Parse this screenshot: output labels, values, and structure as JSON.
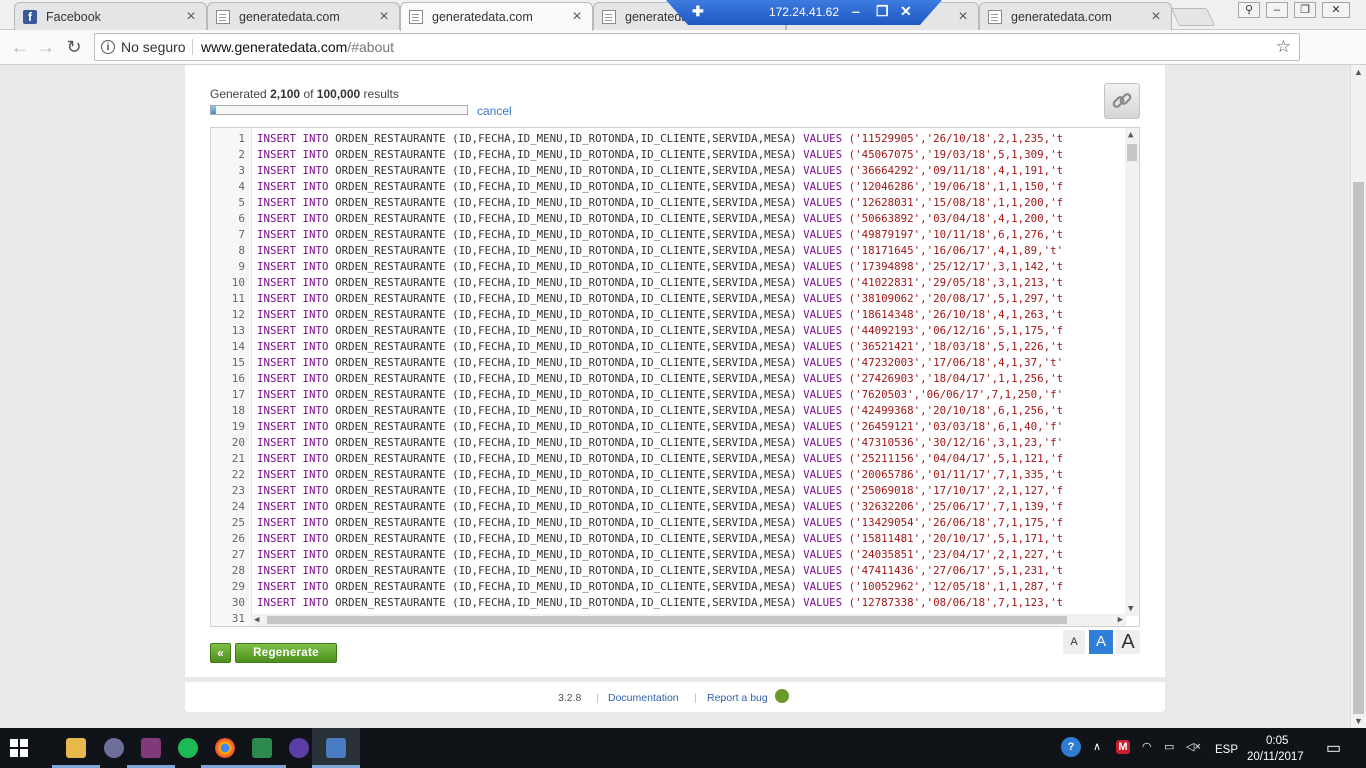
{
  "browser": {
    "tabs": [
      {
        "title": "Facebook",
        "icon": "facebook-icon",
        "active": false
      },
      {
        "title": "generatedata.com",
        "icon": "page-icon",
        "active": false
      },
      {
        "title": "generatedata.com",
        "icon": "page-icon",
        "active": true
      },
      {
        "title": "generatedata.com",
        "icon": "page-icon",
        "active": false
      },
      {
        "title": "generatedata.com",
        "icon": "page-icon",
        "active": false
      },
      {
        "title": "generatedata.com",
        "icon": "page-icon",
        "active": false
      }
    ],
    "remote_session_ip": "172.24.41.62",
    "address": {
      "security_label": "No seguro",
      "host": "www.generatedata.com",
      "path": "/#about"
    }
  },
  "generator": {
    "status_prefix": "Generated",
    "generated_count": "2,100",
    "of_label": "of",
    "total_count": "100,000",
    "results_label": "results",
    "progress_fraction": 0.021,
    "cancel_label": "cancel",
    "regenerate_label": "Regenerate",
    "back_label": "«",
    "font_sizes": [
      "A",
      "A",
      "A"
    ]
  },
  "code": {
    "keywords": [
      "INSERT",
      "INTO",
      "VALUES"
    ],
    "table": "ORDEN_RESTAURANTE",
    "columns": "(ID,FECHA,ID_MENU,ID_ROTONDA,ID_CLIENTE,SERVIDA,MESA)",
    "rows": [
      {
        "n": "1",
        "values": "('11529905','26/10/18',2,1,235,'t"
      },
      {
        "n": "2",
        "values": "('45067075','19/03/18',5,1,309,'t"
      },
      {
        "n": "3",
        "values": "('36664292','09/11/18',4,1,191,'t"
      },
      {
        "n": "4",
        "values": "('12046286','19/06/18',1,1,150,'f"
      },
      {
        "n": "5",
        "values": "('12628031','15/08/18',1,1,200,'f"
      },
      {
        "n": "6",
        "values": "('50663892','03/04/18',4,1,200,'t"
      },
      {
        "n": "7",
        "values": "('49879197','10/11/18',6,1,276,'t"
      },
      {
        "n": "8",
        "values": "('18171645','16/06/17',4,1,89,'t'"
      },
      {
        "n": "9",
        "values": "('17394898','25/12/17',3,1,142,'t"
      },
      {
        "n": "10",
        "values": "('41022831','29/05/18',3,1,213,'t"
      },
      {
        "n": "11",
        "values": "('38109062','20/08/17',5,1,297,'t"
      },
      {
        "n": "12",
        "values": "('18614348','26/10/18',4,1,263,'t"
      },
      {
        "n": "13",
        "values": "('44092193','06/12/16',5,1,175,'f"
      },
      {
        "n": "14",
        "values": "('36521421','18/03/18',5,1,226,'t"
      },
      {
        "n": "15",
        "values": "('47232003','17/06/18',4,1,37,'t'"
      },
      {
        "n": "16",
        "values": "('27426903','18/04/17',1,1,256,'t"
      },
      {
        "n": "17",
        "values": "('7620503','06/06/17',7,1,250,'f'"
      },
      {
        "n": "18",
        "values": "('42499368','20/10/18',6,1,256,'t"
      },
      {
        "n": "19",
        "values": "('26459121','03/03/18',6,1,40,'f'"
      },
      {
        "n": "20",
        "values": "('47310536','30/12/16',3,1,23,'f'"
      },
      {
        "n": "21",
        "values": "('25211156','04/04/17',5,1,121,'f"
      },
      {
        "n": "22",
        "values": "('20065786','01/11/17',7,1,335,'t"
      },
      {
        "n": "23",
        "values": "('25069018','17/10/17',2,1,127,'f"
      },
      {
        "n": "24",
        "values": "('32632206','25/06/17',7,1,139,'f"
      },
      {
        "n": "25",
        "values": "('13429054','26/06/18',7,1,175,'f"
      },
      {
        "n": "26",
        "values": "('15811481','20/10/17',5,1,171,'t"
      },
      {
        "n": "27",
        "values": "('24035851','23/04/17',2,1,227,'t"
      },
      {
        "n": "28",
        "values": "('47411436','27/06/17',5,1,231,'t"
      },
      {
        "n": "29",
        "values": "('10052962','12/05/18',1,1,287,'f"
      },
      {
        "n": "30",
        "values": "('12787338','08/06/18',7,1,123,'t"
      }
    ],
    "last_line_number": "31"
  },
  "footer": {
    "version": "3.2.8",
    "documentation_label": "Documentation",
    "report_bug_label": "Report a bug"
  },
  "taskbar": {
    "language": "ESP",
    "time": "0:05",
    "date": "20/11/2017"
  },
  "colors": {
    "keyword": "#7a0d8e",
    "string": "#a31515",
    "button_green": "#5a9c2a",
    "link_blue": "#3a76c4"
  }
}
